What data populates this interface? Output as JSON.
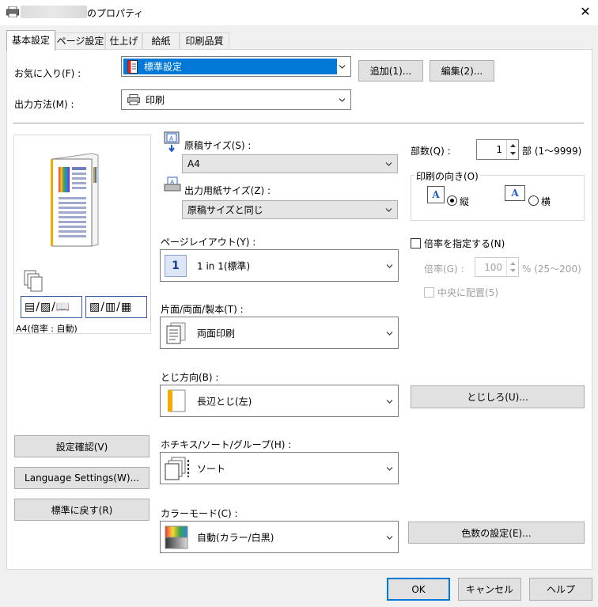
{
  "window": {
    "title_suffix": "のプロパティ",
    "close_glyph": "✕"
  },
  "tabs": [
    {
      "label": "基本設定",
      "active": true
    },
    {
      "label": "ページ設定"
    },
    {
      "label": "仕上げ"
    },
    {
      "label": "給紙"
    },
    {
      "label": "印刷品質"
    }
  ],
  "favorites": {
    "label": "お気に入り(F) :",
    "value": "標準設定",
    "add_button": "追加(1)...",
    "edit_button": "編集(2)..."
  },
  "output_method": {
    "label": "出力方法(M) :",
    "value": "印刷"
  },
  "preview": {
    "caption": "A4(倍率 : 自動)"
  },
  "original_size": {
    "label": "原稿サイズ(S) :",
    "value": "A4"
  },
  "output_paper_size": {
    "label": "出力用紙サイズ(Z) :",
    "value": "原稿サイズと同じ"
  },
  "page_layout": {
    "label": "ページレイアウト(Y) :",
    "value": "1 in 1(標準)",
    "icon_text": "1"
  },
  "duplex": {
    "label": "片面/両面/製本(T) :",
    "value": "両面印刷"
  },
  "binding": {
    "label": "とじ方向(B) :",
    "value": "長辺とじ(左)"
  },
  "stapler": {
    "label": "ホチキス/ソート/グループ(H) :",
    "value": "ソート"
  },
  "color_mode": {
    "label": "カラーモード(C) :",
    "value": "自動(カラー/白黒)"
  },
  "copies": {
    "label": "部数(Q) :",
    "value": "1",
    "unit": "部 (1〜9999)"
  },
  "orientation": {
    "group_title": "印刷の向き(O)",
    "portrait": "縦",
    "landscape": "横",
    "icon_letter": "A",
    "selected": "portrait"
  },
  "scale": {
    "checkbox_label": "倍率を指定する(N)",
    "label": "倍率(G) :",
    "value": "100",
    "unit": "% (25〜200)",
    "center_label": "中央に配置(5)"
  },
  "buttons": {
    "gutter": "とじしろ(U)...",
    "color_settings": "色数の設定(E)...",
    "confirm": "設定確認(V)",
    "language": "Language Settings(W)...",
    "restore": "標準に戻す(R)",
    "ok": "OK",
    "cancel": "キャンセル",
    "help": "ヘルプ"
  },
  "colors": {
    "selection_blue": "#0078d7",
    "panel_bg": "#ffffff",
    "dialog_bg": "#f0f0f0"
  }
}
